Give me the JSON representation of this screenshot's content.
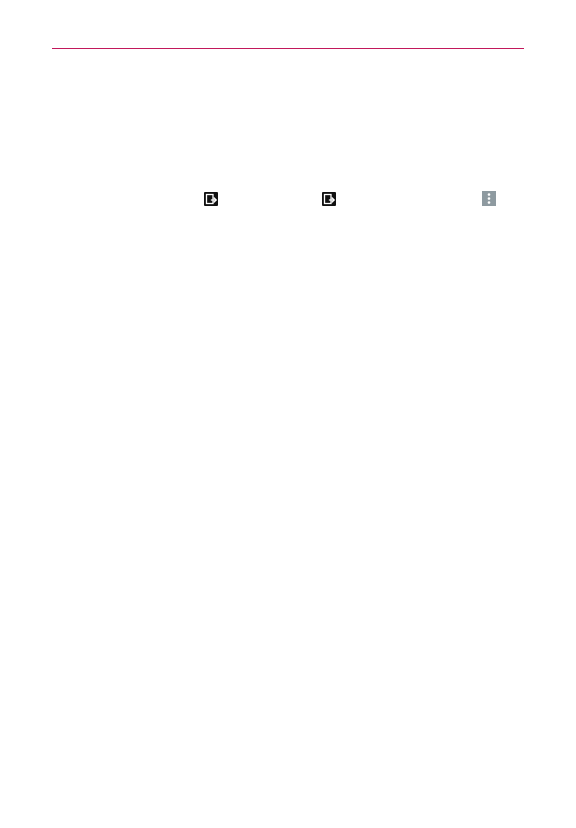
{
  "colors": {
    "header_rule": "#c2185b",
    "export_icon": "#111111",
    "menu_icon_bg": "#8e9aa0",
    "menu_icon_dots": "#ffffff"
  },
  "icons": {
    "first": "export-icon",
    "second": "export-icon",
    "third": "overflow-menu-icon"
  }
}
